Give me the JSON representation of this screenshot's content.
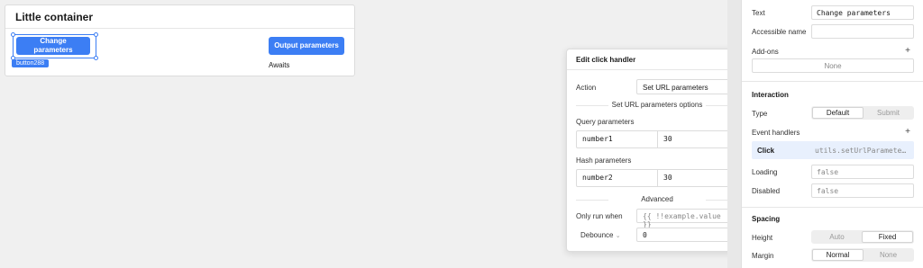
{
  "canvas": {
    "container_title": "Little container",
    "change_button_label": "Change parameters",
    "selection_tag": "button288",
    "output_button_label": "Output parameters",
    "awaits_text": "Awaits"
  },
  "popup": {
    "title": "Edit click handler",
    "close_icon": "×",
    "action_label": "Action",
    "action_value": "Set URL parameters",
    "options_heading": "Set URL parameters options",
    "query_label": "Query parameters",
    "query_rows": [
      {
        "key": "number1",
        "value": "30"
      }
    ],
    "hash_label": "Hash parameters",
    "hash_rows": [
      {
        "key": "number2",
        "value": "30"
      }
    ],
    "advanced_heading": "Advanced",
    "only_run_label": "Only run when",
    "only_run_placeholder": "{{ !!example.value }}",
    "debounce_label": "Debounce",
    "debounce_value": "0"
  },
  "panel": {
    "text_label": "Text",
    "text_value": "Change parameters",
    "accessible_label": "Accessible name",
    "accessible_value": "",
    "addons_label": "Add-ons",
    "none_label": "None",
    "interaction_heading": "Interaction",
    "type_label": "Type",
    "type_options": [
      "Default",
      "Submit"
    ],
    "type_selected": "Default",
    "event_handlers_label": "Event handlers",
    "event_name": "Click",
    "event_value": "utils.setUrlParamete…",
    "loading_label": "Loading",
    "loading_placeholder": "false",
    "disabled_label": "Disabled",
    "disabled_placeholder": "false",
    "spacing_heading": "Spacing",
    "height_label": "Height",
    "height_options": [
      "Auto",
      "Fixed"
    ],
    "height_selected": "Fixed",
    "margin_label": "Margin",
    "margin_options": [
      "Normal",
      "None"
    ],
    "margin_selected": "Normal"
  },
  "colors": {
    "accent": "#3c7ef4",
    "event_row_bg": "#e8f0fd"
  }
}
